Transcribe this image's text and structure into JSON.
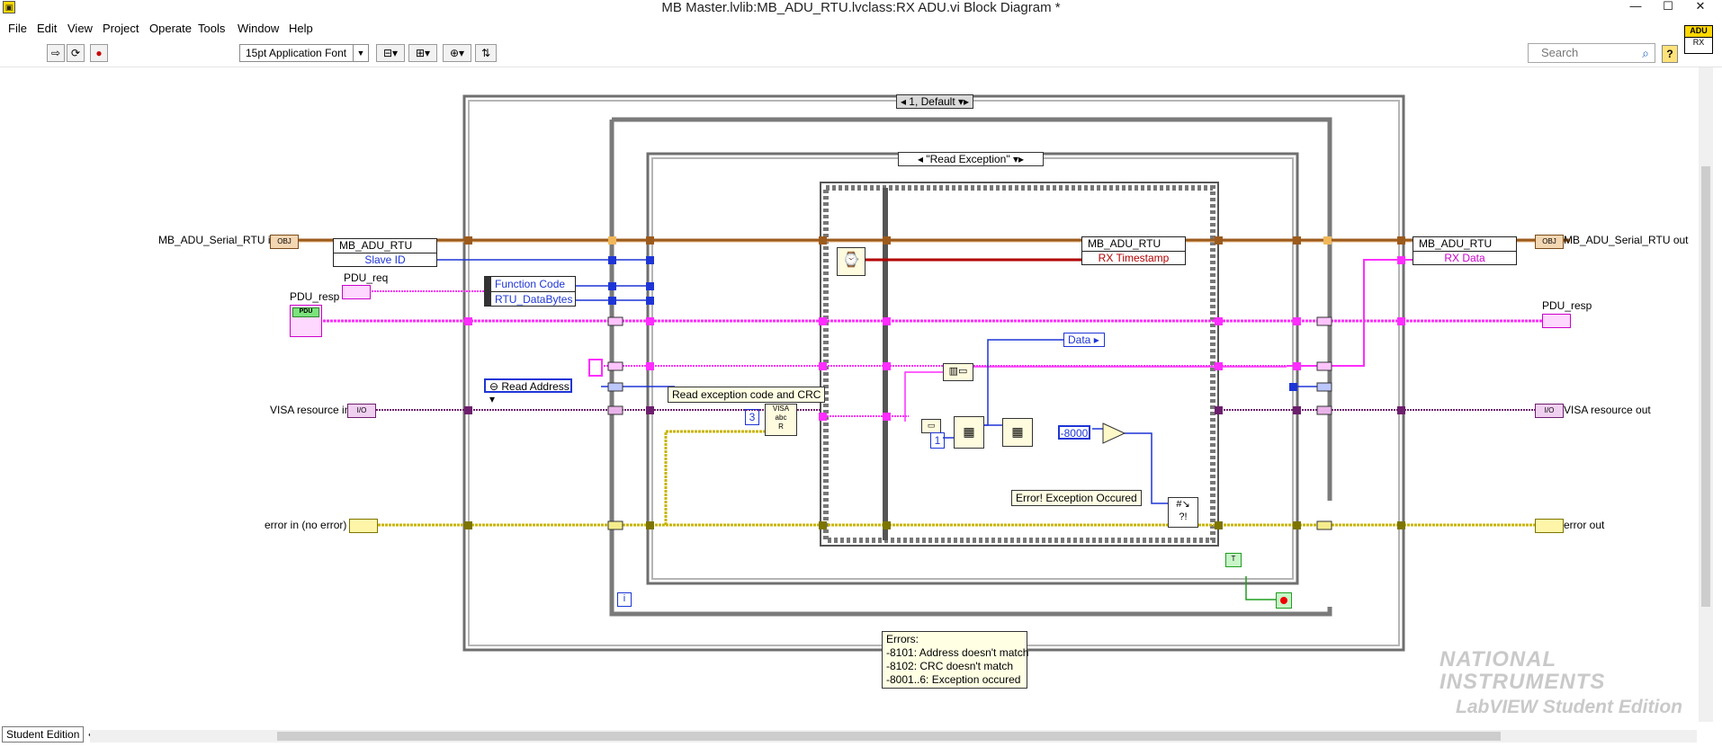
{
  "window": {
    "title": "MB Master.lvlib:MB_ADU_RTU.lvclass:RX ADU.vi Block Diagram *",
    "min": "—",
    "max": "☐",
    "close": "✕"
  },
  "menu": [
    "File",
    "Edit",
    "View",
    "Project",
    "Operate",
    "Tools",
    "Window",
    "Help"
  ],
  "toolbar": {
    "font": "15pt Application Font",
    "search_placeholder": "Search",
    "help": "?"
  },
  "vi_icon": {
    "top": "ADU",
    "bottom": "RX"
  },
  "diagram": {
    "outer_case_selector": "1, Default",
    "inner_case_selector": "\"Read Exception\"",
    "terminals": {
      "serial_in": "MB_ADU_Serial_RTU in",
      "serial_out": "MB_ADU_Serial_RTU out",
      "pdu_req": "PDU_req",
      "pdu_resp_in": "PDU_resp",
      "pdu_resp_out": "PDU_resp",
      "visa_in": "VISA resource in",
      "visa_out": "VISA resource out",
      "error_in": "error in (no error)",
      "error_out": "error out"
    },
    "unbundle_left": {
      "class": "MB_ADU_RTU",
      "field": "Slave ID"
    },
    "unbundle_mid": {
      "field1": "Function Code",
      "field2": "RTU_DataBytes"
    },
    "bundle_right": {
      "class": "MB_ADU_RTU",
      "field": "RX Timestamp"
    },
    "bundle_far": {
      "class": "MB_ADU_RTU",
      "field": "RX Data"
    },
    "read_address": "Read Address",
    "comment_read": "Read exception code and CRC",
    "const_3": "3",
    "const_1": "1",
    "const_err": "-8000",
    "data_label": "Data",
    "err_label": "Error! Exception Occured",
    "errors_note": [
      "Errors:",
      "-8101: Address doesn't match",
      "-8102: CRC doesn't match",
      "-8001..6: Exception occured"
    ],
    "loop_index": "i",
    "obj_icon": "OBJ",
    "io_icon": "I/O",
    "pdu_icon": "PDU"
  },
  "watermark": {
    "line1": "NATIONAL",
    "line2": "INSTRUMENTS",
    "line3": "LabVIEW Student Edition"
  },
  "status": {
    "edition": "Student Edition"
  },
  "colors": {
    "class_wire": "#9c5b1d",
    "cluster_wire": "#ff2dff",
    "refnum_wire": "#6d1f6d",
    "error_wire": "#c8b400",
    "int_wire": "#1e35d6",
    "timestamp_wire": "#b30000"
  }
}
